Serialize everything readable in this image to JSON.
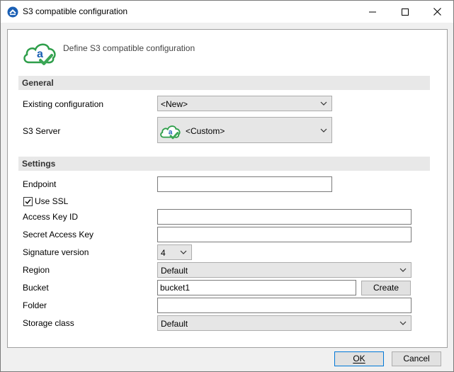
{
  "window": {
    "title": "S3 compatible configuration"
  },
  "header": {
    "text": "Define S3 compatible configuration"
  },
  "sections": {
    "general": "General",
    "settings": "Settings"
  },
  "general": {
    "existing_label": "Existing configuration",
    "existing_value": "<New>",
    "server_label": "S3 Server",
    "server_value": "<Custom>"
  },
  "settings": {
    "endpoint_label": "Endpoint",
    "endpoint_value": "",
    "use_ssl_label": "Use SSL",
    "use_ssl_checked": true,
    "access_key_label": "Access Key ID",
    "access_key_value": "",
    "secret_key_label": "Secret Access Key",
    "secret_key_value": "",
    "signature_label": "Signature version",
    "signature_value": "4",
    "region_label": "Region",
    "region_value": "Default",
    "bucket_label": "Bucket",
    "bucket_value": "bucket1",
    "create_label": "Create",
    "folder_label": "Folder",
    "folder_value": "",
    "storage_label": "Storage class",
    "storage_value": "Default"
  },
  "footer": {
    "ok_label": "OK",
    "cancel_label": "Cancel"
  },
  "colors": {
    "cloud_green": "#2e9e4a",
    "logo_blue": "#1a5fb4",
    "check_green": "#3aa655"
  }
}
